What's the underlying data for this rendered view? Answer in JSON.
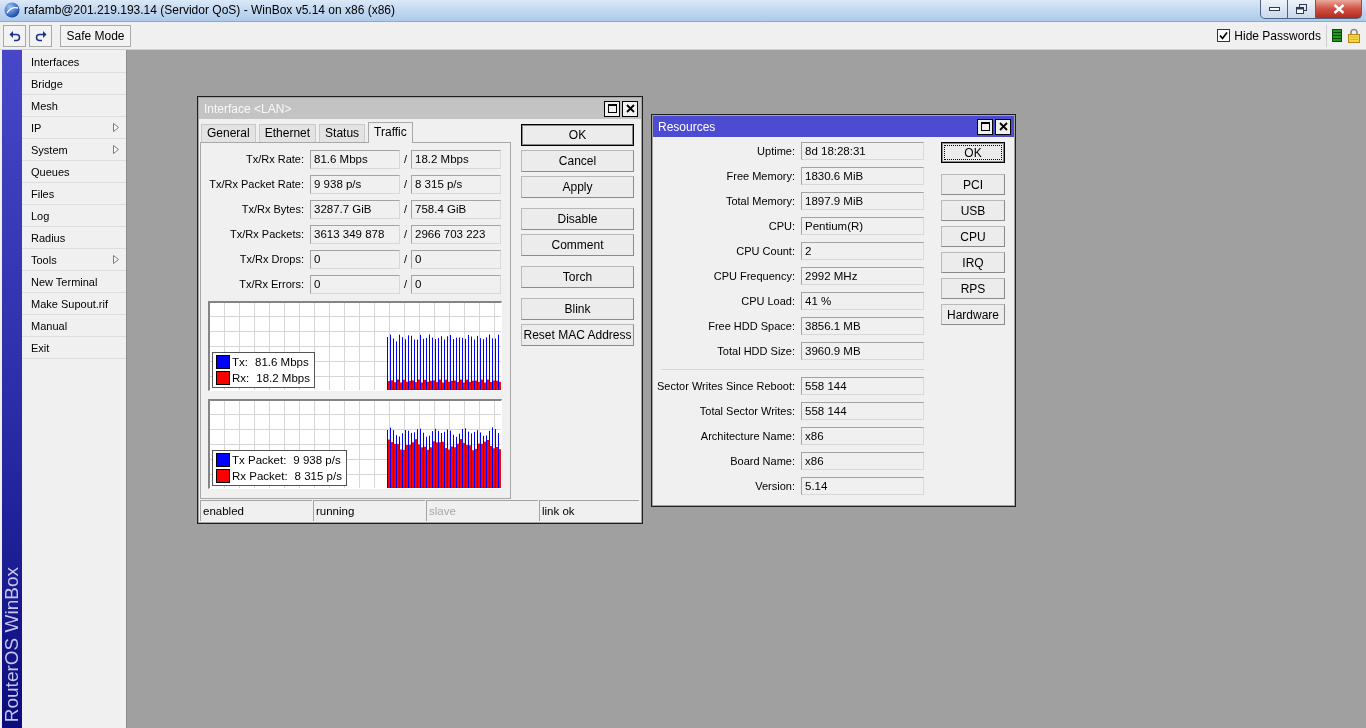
{
  "window": {
    "title": "rafamb@201.219.193.14 (Servidor QoS) - WinBox v5.14 on x86 (x86)"
  },
  "toolbar": {
    "safe_mode": "Safe Mode",
    "hide_passwords": {
      "label": "Hide Passwords",
      "checked": true
    }
  },
  "sidebar": {
    "brand": "RouterOS WinBox",
    "items": [
      {
        "label": "Interfaces",
        "submenu": false
      },
      {
        "label": "Bridge",
        "submenu": false
      },
      {
        "label": "Mesh",
        "submenu": false
      },
      {
        "label": "IP",
        "submenu": true
      },
      {
        "label": "System",
        "submenu": true
      },
      {
        "label": "Queues",
        "submenu": false
      },
      {
        "label": "Files",
        "submenu": false
      },
      {
        "label": "Log",
        "submenu": false
      },
      {
        "label": "Radius",
        "submenu": false
      },
      {
        "label": "Tools",
        "submenu": true
      },
      {
        "label": "New Terminal",
        "submenu": false
      },
      {
        "label": "Make Supout.rif",
        "submenu": false
      },
      {
        "label": "Manual",
        "submenu": false
      },
      {
        "label": "Exit",
        "submenu": false
      }
    ]
  },
  "interface_window": {
    "title": "Interface <LAN>",
    "active": false,
    "tabs": [
      {
        "label": "General",
        "selected": false
      },
      {
        "label": "Ethernet",
        "selected": false
      },
      {
        "label": "Status",
        "selected": false
      },
      {
        "label": "Traffic",
        "selected": true
      }
    ],
    "rows": [
      {
        "label": "Tx/Rx Rate:",
        "tx": "81.6 Mbps",
        "separator": "/",
        "rx": "18.2 Mbps"
      },
      {
        "label": "Tx/Rx Packet Rate:",
        "tx": "9 938 p/s",
        "separator": "/",
        "rx": "8 315 p/s"
      },
      {
        "label": "Tx/Rx Bytes:",
        "tx": "3287.7 GiB",
        "separator": "/",
        "rx": "758.4 GiB"
      },
      {
        "label": "Tx/Rx Packets:",
        "tx": "3613 349 878",
        "separator": "/",
        "rx": "2966 703 223"
      },
      {
        "label": "Tx/Rx Drops:",
        "tx": "0",
        "separator": "/",
        "rx": "0"
      },
      {
        "label": "Tx/Rx Errors:",
        "tx": "0",
        "separator": "/",
        "rx": "0"
      }
    ],
    "graphs": [
      {
        "legend": [
          {
            "label": "Tx:",
            "value": "81.6 Mbps",
            "color": "#0000ff"
          },
          {
            "label": "Rx:",
            "value": "18.2 Mbps",
            "color": "#ff0000"
          }
        ]
      },
      {
        "legend": [
          {
            "label": "Tx Packet:",
            "value": "9 938 p/s",
            "color": "#0000ff"
          },
          {
            "label": "Rx Packet:",
            "value": "8 315 p/s",
            "color": "#ff0000"
          }
        ]
      }
    ],
    "button_groups": [
      {
        "buttons": [
          {
            "label": "OK",
            "default": true,
            "focused": false
          },
          {
            "label": "Cancel",
            "default": false,
            "focused": false
          },
          {
            "label": "Apply",
            "default": false,
            "focused": false
          }
        ]
      },
      {
        "buttons": [
          {
            "label": "Disable",
            "default": false,
            "focused": false
          },
          {
            "label": "Comment",
            "default": false,
            "focused": false
          }
        ]
      },
      {
        "buttons": [
          {
            "label": "Torch",
            "default": false,
            "focused": false
          }
        ]
      },
      {
        "buttons": [
          {
            "label": "Blink",
            "default": false,
            "focused": false
          },
          {
            "label": "Reset MAC Address",
            "default": false,
            "focused": false
          }
        ]
      }
    ],
    "status": [
      {
        "text": "enabled",
        "disabled": false
      },
      {
        "text": "running",
        "disabled": false
      },
      {
        "text": "slave",
        "disabled": true
      },
      {
        "text": "link ok",
        "disabled": false
      }
    ]
  },
  "resources_window": {
    "title": "Resources",
    "active": true,
    "sections": [
      {
        "rows": [
          {
            "label": "Uptime:",
            "value": "8d 18:28:31"
          },
          {
            "label": "Free Memory:",
            "value": "1830.6 MiB"
          },
          {
            "label": "Total Memory:",
            "value": "1897.9 MiB"
          },
          {
            "label": "CPU:",
            "value": "Pentium(R)"
          },
          {
            "label": "CPU Count:",
            "value": "2"
          },
          {
            "label": "CPU Frequency:",
            "value": "2992 MHz"
          },
          {
            "label": "CPU Load:",
            "value": "41 %"
          },
          {
            "label": "Free HDD Space:",
            "value": "3856.1 MB"
          },
          {
            "label": "Total HDD Size:",
            "value": "3960.9 MB"
          }
        ]
      },
      {
        "rows": [
          {
            "label": "Sector Writes Since Reboot:",
            "value": "558 144"
          },
          {
            "label": "Total Sector Writes:",
            "value": "558 144"
          },
          {
            "label": "Architecture Name:",
            "value": "x86"
          },
          {
            "label": "Board Name:",
            "value": "x86"
          },
          {
            "label": "Version:",
            "value": "5.14"
          }
        ]
      }
    ],
    "button_groups": [
      {
        "buttons": [
          {
            "label": "OK",
            "default": true,
            "focused": true
          }
        ]
      },
      {
        "buttons": [
          {
            "label": "PCI",
            "default": false,
            "focused": false
          },
          {
            "label": "USB",
            "default": false,
            "focused": false
          },
          {
            "label": "CPU",
            "default": false,
            "focused": false
          },
          {
            "label": "IRQ",
            "default": false,
            "focused": false
          },
          {
            "label": "RPS",
            "default": false,
            "focused": false
          },
          {
            "label": "Hardware",
            "default": false,
            "focused": false
          }
        ]
      }
    ]
  }
}
